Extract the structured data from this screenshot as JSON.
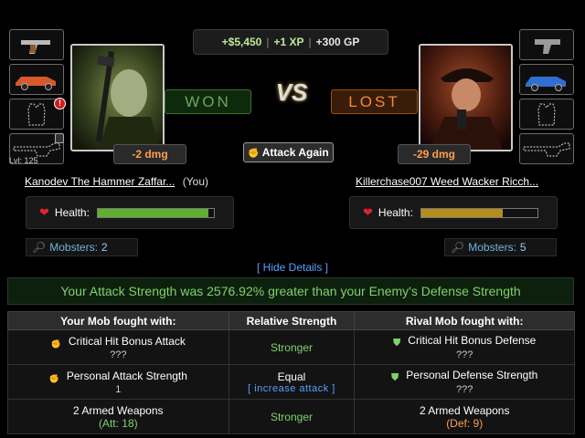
{
  "rewards": {
    "cash": "+$5,450",
    "xp": "+1 XP",
    "gp": "+300 GP"
  },
  "player": {
    "name": "Kanodev The Hammer Zaffar...",
    "you_label": "(You)",
    "level": "Lvl: 125",
    "damage": "-2 dmg",
    "result": "WON",
    "health_label": "Health:",
    "health_pct": 0.95,
    "health_color": "#5fb030",
    "mobsters_label": "Mobsters:",
    "mobsters": "2"
  },
  "rival": {
    "name": "Killerchase007 Weed Wacker Ricch...",
    "damage": "-29 dmg",
    "result": "LOST",
    "health_label": "Health:",
    "health_pct": 0.7,
    "health_color": "#b58d1d",
    "mobsters_label": "Mobsters:",
    "mobsters": "5"
  },
  "vs_label": "VS",
  "attack_again": "Attack Again",
  "hide_details": "[ Hide Details ]",
  "strength_banner": "Your Attack Strength was 2576.92% greater than your Enemy's Defense Strength",
  "table": {
    "headers": [
      "Your Mob fought with:",
      "Relative Strength",
      "Rival Mob fought with:"
    ],
    "rows": [
      {
        "left": "Critical Hit Bonus Attack",
        "left_sub": "???",
        "mid": "Stronger",
        "mid_sub": "",
        "right": "Critical Hit Bonus Defense",
        "right_sub": "???"
      },
      {
        "left": "Personal Attack Strength",
        "left_sub": "1",
        "mid": "Equal",
        "mid_sub": "[ increase attack ]",
        "right": "Personal Defense Strength",
        "right_sub": "???"
      },
      {
        "left": "2 Armed Weapons",
        "left_sub": "(Att: 18)",
        "mid": "Stronger",
        "mid_sub": "",
        "right": "2 Armed Weapons",
        "right_sub": "(Def: 9)"
      }
    ]
  },
  "colors": {
    "won": "#6fa55a",
    "lost": "#f08a3a",
    "link": "#5aa0ff",
    "positive": "#7fd36b"
  }
}
